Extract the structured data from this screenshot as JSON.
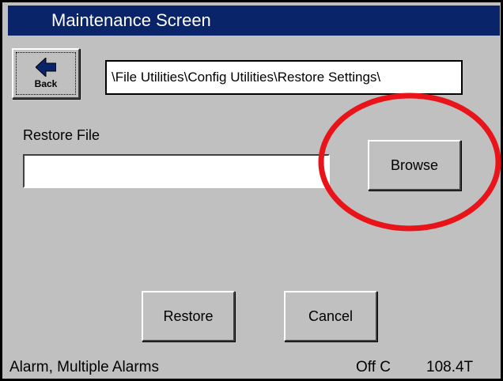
{
  "window": {
    "title": "Maintenance Screen"
  },
  "toolbar": {
    "back_label": "Back",
    "back_icon": "arrow-left-icon"
  },
  "path": "\\File Utilities\\Config Utilities\\Restore Settings\\",
  "form": {
    "restore_file_label": "Restore File",
    "restore_file_value": "",
    "browse_label": "Browse"
  },
  "actions": {
    "restore_label": "Restore",
    "cancel_label": "Cancel"
  },
  "status": {
    "alarm_text": "Alarm, Multiple Alarms",
    "mode": "Off C",
    "temperature": "108.4T"
  },
  "colors": {
    "titlebar": "#0a246a",
    "background": "#c0c0c0",
    "highlight_circle": "#e8141a"
  }
}
